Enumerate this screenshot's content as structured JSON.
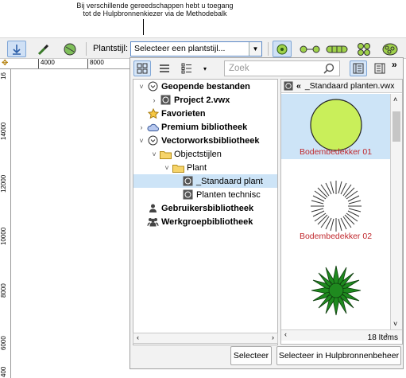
{
  "callout": {
    "line1": "Bij verschillende gereedschappen hebt u toegang",
    "line2": "tot de Hulpbronnenkiezer via de Methodebalk"
  },
  "toolbar": {
    "plant_style_label": "Plantstijl:",
    "plant_style_value": "Selecteer een plantstijl..."
  },
  "rulers": {
    "top": [
      "4000",
      "8000"
    ],
    "left": [
      "16",
      "14000",
      "12000",
      "10000",
      "8000",
      "6000",
      "400"
    ]
  },
  "panel": {
    "search_placeholder": "Zoek",
    "more_label": "»",
    "tree": [
      {
        "label": "Geopende bestanden",
        "icon": "circle-chevron-icon",
        "expander": "down",
        "bold": true
      },
      {
        "label": "Project 2.vwx",
        "icon": "vwx-file-icon",
        "expander": "right",
        "bold": true
      },
      {
        "label": "Favorieten",
        "icon": "star-icon",
        "expander": "",
        "bold": true
      },
      {
        "label": "Premium bibliotheek",
        "icon": "cloud-icon",
        "expander": "right",
        "bold": true
      },
      {
        "label": "Vectorworksbibliotheek",
        "icon": "circle-chevron-icon",
        "expander": "down",
        "bold": true
      },
      {
        "label": "Objectstijlen",
        "icon": "folder-icon",
        "expander": "down",
        "bold": false
      },
      {
        "label": "Plant",
        "icon": "folder-icon",
        "expander": "down",
        "bold": false
      },
      {
        "label": "_Standaard plant",
        "icon": "vwx-file-icon",
        "expander": "",
        "bold": false
      },
      {
        "label": "Planten technisc",
        "icon": "vwx-file-icon",
        "expander": "",
        "bold": false
      },
      {
        "label": "Gebruikersbibliotheek",
        "icon": "user-library-icon",
        "expander": "",
        "bold": true
      },
      {
        "label": "Werkgroepbibliotheek",
        "icon": "group-library-icon",
        "expander": "",
        "bold": true
      }
    ],
    "preview_header": "_Standaard planten.vwx",
    "preview_back": "«",
    "tiles": [
      {
        "label": "Bodembedekker 01"
      },
      {
        "label": "Bodembedekker 02"
      },
      {
        "label": ""
      }
    ],
    "items_count": "18 Items",
    "select_button": "Selecteer",
    "select_in_manager_button": "Selecteer in Hulpbronnenbeheer"
  },
  "colors": {
    "accent": "#cde4f7",
    "tile_label": "#c0282d",
    "plant_green": "#c9ef5a"
  }
}
